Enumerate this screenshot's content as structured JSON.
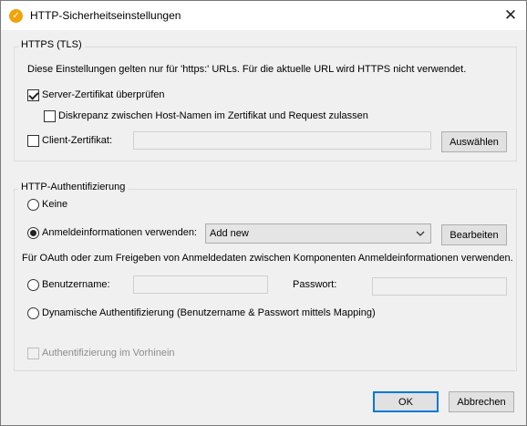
{
  "window": {
    "title": "HTTP-Sicherheitseinstellungen",
    "icon": "altova-app-icon",
    "close_glyph": "✕"
  },
  "https_group": {
    "label": "HTTPS (TLS)",
    "info": "Diese Einstellungen gelten nur für 'https:' URLs. Für die aktuelle URL wird HTTPS nicht verwendet.",
    "verify_server_cert": {
      "label": "Server-Zertifikat überprüfen",
      "checked": true
    },
    "allow_hostname_mismatch": {
      "label": "Diskrepanz zwischen Host-Namen im Zertifikat und Request zulassen",
      "checked": false
    },
    "client_cert": {
      "label": "Client-Zertifikat:",
      "checked": false,
      "value": ""
    },
    "browse_button": "Auswählen"
  },
  "auth_group": {
    "label": "HTTP-Authentifizierung",
    "none_option": "Keine",
    "credentials_option": "Anmeldeinformationen verwenden:",
    "credentials_select": "Add new",
    "edit_button": "Bearbeiten",
    "oauth_info": "Für OAuth oder zum Freigeben von Anmeldedaten zwischen Komponenten Anmeldeinformationen verwenden.",
    "username_option": "Benutzername:",
    "password_label": "Passwort:",
    "dynamic_option": "Dynamische Authentifizierung (Benutzername & Passwort mittels Mapping)",
    "preemptive": {
      "label": "Authentifizierung im Vorhinein",
      "checked": false,
      "disabled": true
    },
    "selected_option": "credentials"
  },
  "footer": {
    "ok": "OK",
    "cancel": "Abbrechen"
  }
}
